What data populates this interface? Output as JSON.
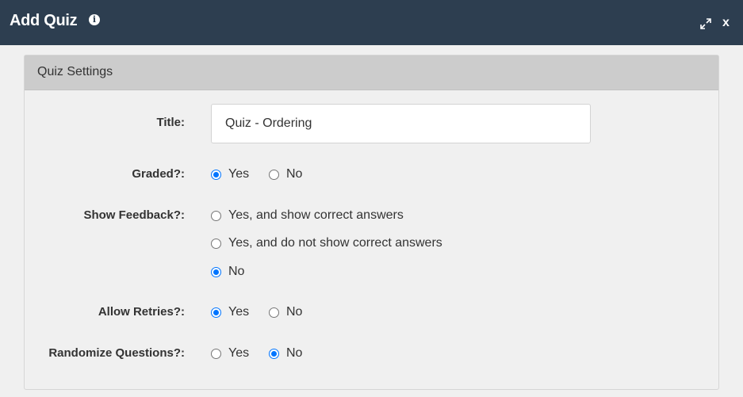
{
  "window": {
    "title": "Add Quiz",
    "close_label": "x"
  },
  "panel": {
    "title": "Quiz Settings"
  },
  "form": {
    "title": {
      "label": "Title:",
      "value": "Quiz - Ordering"
    },
    "graded": {
      "label": "Graded?:",
      "options": [
        "Yes",
        "No"
      ],
      "selected": "Yes"
    },
    "show_feedback": {
      "label": "Show Feedback?:",
      "options": [
        "Yes, and show correct answers",
        "Yes, and do not show correct answers",
        "No"
      ],
      "selected": "No"
    },
    "allow_retries": {
      "label": "Allow Retries?:",
      "options": [
        "Yes",
        "No"
      ],
      "selected": "Yes"
    },
    "randomize_questions": {
      "label": "Randomize Questions?:",
      "options": [
        "Yes",
        "No"
      ],
      "selected": "No"
    }
  },
  "colors": {
    "titlebar": "#2d3e50",
    "panel_header": "#cccccc",
    "radio_accent": "#0075ff"
  }
}
